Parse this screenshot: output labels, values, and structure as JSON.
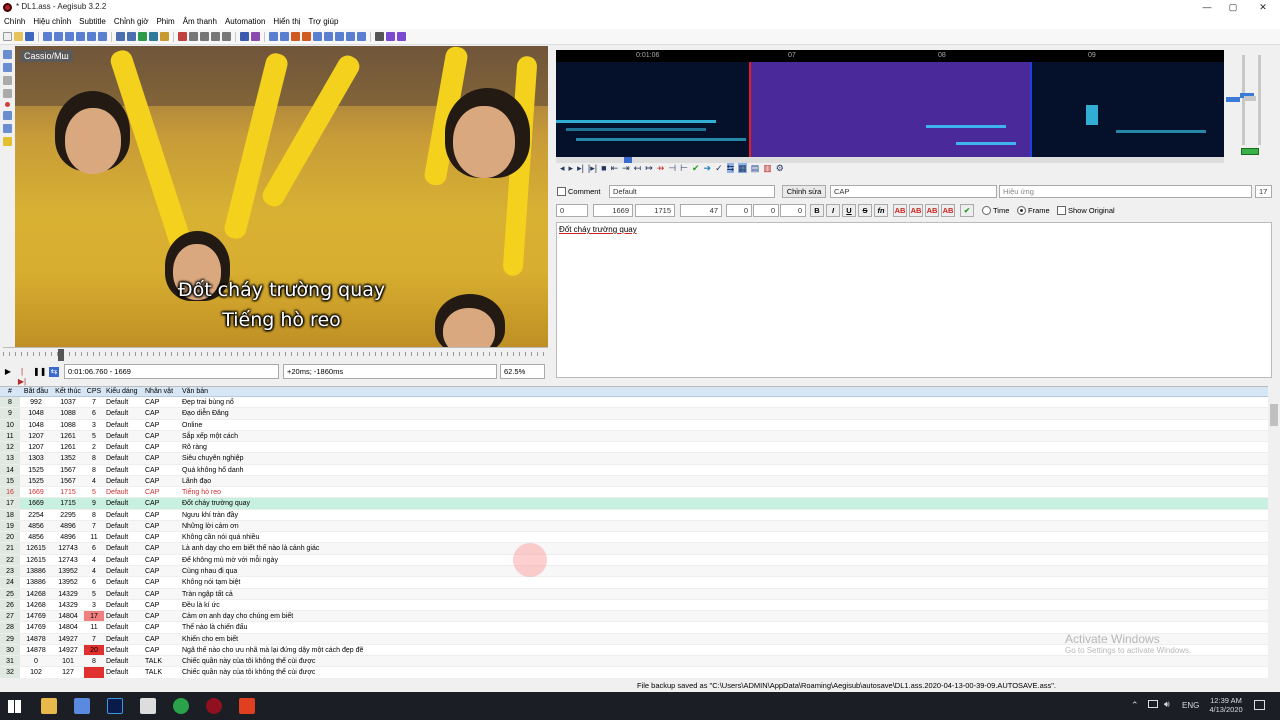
{
  "window": {
    "title": "* DL1.ass - Aegisub 3.2.2",
    "minimize": "—",
    "maximize": "▢",
    "close": "✕"
  },
  "menu": [
    "Chính",
    "Hiệu chỉnh",
    "Subtitle",
    "Chỉnh giờ",
    "Phim",
    "Âm thanh",
    "Automation",
    "Hiển thị",
    "Trợ giúp"
  ],
  "video": {
    "badge": "Cassio/Мш",
    "subtitle_line1": "Đốt cháy trường quay",
    "subtitle_line2": "Tiếng hò reo",
    "time_frame": "0:01:06.760 - 1669",
    "offset": "+20ms; -1860ms",
    "zoom": "62.5%",
    "seek_position": 0.1
  },
  "audio": {
    "ruler_labels": [
      "0:01:06",
      "07",
      "08",
      "09"
    ],
    "selection_start": 0.29,
    "selection_end": 0.71
  },
  "edit": {
    "comment_label": "Comment",
    "style": "Default",
    "actor_button": "Chỉnh sửa",
    "actor": "CAP",
    "effect_placeholder": "Hiệu ứng",
    "char_count": "17",
    "layer": "0",
    "start": "1669",
    "end": "1715",
    "duration": "47",
    "margin_l": "0",
    "margin_r": "0",
    "margin_v": "0",
    "bold": "B",
    "italic": "I",
    "underline": "U",
    "strike": "S",
    "font": "fn",
    "colors": [
      "AB",
      "AB",
      "AB",
      "AB"
    ],
    "time_radio": "Time",
    "frame_radio": "Frame",
    "show_original": "Show Original",
    "text": "Đốt cháy trường quay"
  },
  "grid": {
    "headers": [
      "#",
      "Bắt đầu",
      "Kết thúc",
      "CPS",
      "Kiểu dáng",
      "Nhân vật",
      "Văn bản"
    ],
    "rows": [
      [
        "8",
        "992",
        "1037",
        "7",
        "Default",
        "CAP",
        "Đẹp trai bùng nổ"
      ],
      [
        "9",
        "1048",
        "1088",
        "6",
        "Default",
        "CAP",
        "Đạo diễn Đăng"
      ],
      [
        "10",
        "1048",
        "1088",
        "3",
        "Default",
        "CAP",
        "Online"
      ],
      [
        "11",
        "1207",
        "1261",
        "5",
        "Default",
        "CAP",
        "Sắp xếp một cách"
      ],
      [
        "12",
        "1207",
        "1261",
        "2",
        "Default",
        "CAP",
        "Rõ ràng"
      ],
      [
        "13",
        "1303",
        "1352",
        "8",
        "Default",
        "CAP",
        "Siêu chuyên nghiệp"
      ],
      [
        "14",
        "1525",
        "1567",
        "8",
        "Default",
        "CAP",
        "Quá không hổ danh"
      ],
      [
        "15",
        "1525",
        "1567",
        "4",
        "Default",
        "CAP",
        "Lãnh đạo"
      ],
      [
        "16",
        "1669",
        "1715",
        "5",
        "Default",
        "CAP",
        "Tiếng hò reo"
      ],
      [
        "17",
        "1669",
        "1715",
        "9",
        "Default",
        "CAP",
        "Đốt cháy trường quay"
      ],
      [
        "18",
        "2254",
        "2295",
        "8",
        "Default",
        "CAP",
        "Ngưu khí tràn đầy"
      ],
      [
        "19",
        "4856",
        "4896",
        "7",
        "Default",
        "CAP",
        "Những lời cảm ơn"
      ],
      [
        "20",
        "4856",
        "4896",
        "11",
        "Default",
        "CAP",
        "Không cần nói quá nhiều"
      ],
      [
        "21",
        "12615",
        "12743",
        "6",
        "Default",
        "CAP",
        "Là anh dạy cho em biết thế nào là cảnh giác"
      ],
      [
        "22",
        "12615",
        "12743",
        "4",
        "Default",
        "CAP",
        "Để không mù mờ với mỗi ngày"
      ],
      [
        "23",
        "13886",
        "13952",
        "4",
        "Default",
        "CAP",
        "Cùng nhau đi qua"
      ],
      [
        "24",
        "13886",
        "13952",
        "6",
        "Default",
        "CAP",
        "Không nói tạm biệt"
      ],
      [
        "25",
        "14268",
        "14329",
        "5",
        "Default",
        "CAP",
        "Tràn ngập tất cả"
      ],
      [
        "26",
        "14268",
        "14329",
        "3",
        "Default",
        "CAP",
        "Đều là kí ức"
      ],
      [
        "27",
        "14769",
        "14804",
        "17",
        "Default",
        "CAP",
        "Cảm ơn anh dạy cho chúng em biết"
      ],
      [
        "28",
        "14769",
        "14804",
        "11",
        "Default",
        "CAP",
        "Thế nào là chiến đấu"
      ],
      [
        "29",
        "14878",
        "14927",
        "7",
        "Default",
        "CAP",
        "Khiến cho em biết"
      ],
      [
        "30",
        "14878",
        "14927",
        "20",
        "Default",
        "CAP",
        "Ngã thế nào cho ưu nhã mà lại đứng dậy một cách đẹp đẽ"
      ],
      [
        "31",
        "0",
        "101",
        "8",
        "Default",
        "TALK",
        "Chiếc quần này của tôi không thể cùi được"
      ],
      [
        "32",
        "102",
        "127",
        "",
        "Default",
        "TALK",
        "Chiếc quần này của tôi không thể cùi được"
      ]
    ]
  },
  "status": "File backup saved as \"C:\\Users\\ADMIN\\AppData\\Roaming\\Aegisub\\autosave\\DL1.ass.2020-04-13-00-39-09.AUTOSAVE.ass\".",
  "watermark": {
    "line1": "Activate Windows",
    "line2": "Go to Settings to activate Windows."
  },
  "taskbar": {
    "language": "ENG",
    "time": "12:39 AM",
    "date": "4/13/2020"
  },
  "colors": {
    "selected_row": "#c8f0e0",
    "previous_row_text": "#d03030",
    "cps_warn": "#f08080",
    "cps_high": "#e03030",
    "waveform_selection": "#4a2a9a"
  }
}
